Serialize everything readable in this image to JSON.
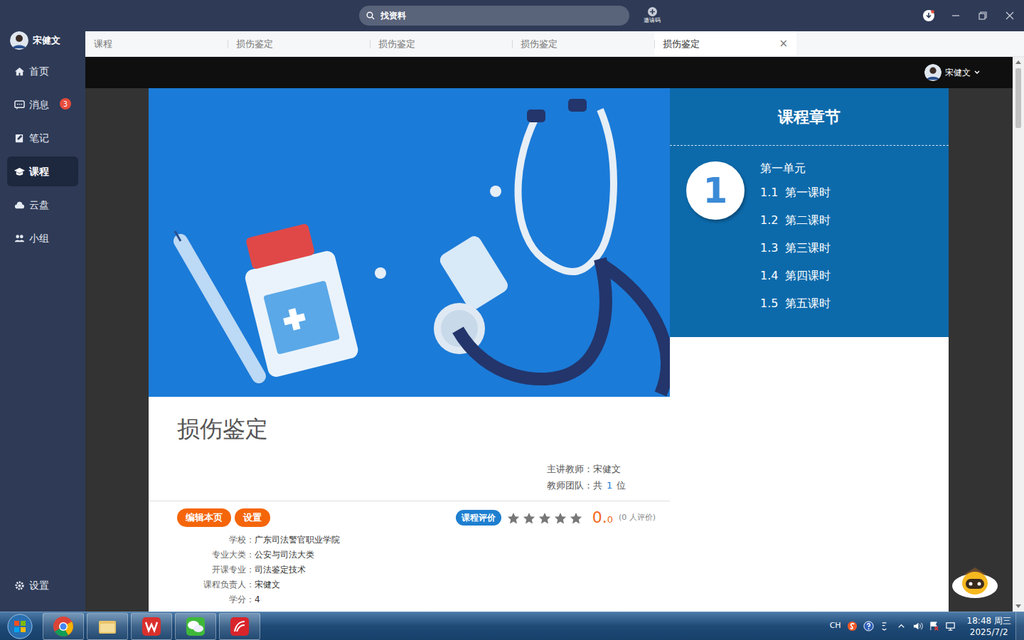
{
  "window": {
    "search_placeholder": "找资料",
    "invite_label": "邀请码"
  },
  "user": {
    "name": "宋健文"
  },
  "sidebar": {
    "items": [
      {
        "label": "首页",
        "selected": false
      },
      {
        "label": "消息",
        "badge": "3",
        "selected": false
      },
      {
        "label": "笔记",
        "selected": false
      },
      {
        "label": "课程",
        "selected": true
      },
      {
        "label": "云盘",
        "selected": false
      },
      {
        "label": "小组",
        "selected": false
      }
    ],
    "settings": "设置"
  },
  "tabs": [
    {
      "label": "课程",
      "selected": false
    },
    {
      "label": "损伤鉴定",
      "selected": false
    },
    {
      "label": "损伤鉴定",
      "selected": false
    },
    {
      "label": "损伤鉴定",
      "selected": false
    },
    {
      "label": "损伤鉴定",
      "selected": true,
      "close": "×"
    }
  ],
  "header": {
    "user": "宋健文"
  },
  "chapters": {
    "title": "课程章节",
    "unit_number": "1",
    "unit_title": "第一单元",
    "lessons": [
      {
        "number": "1.1",
        "title": "第一课时"
      },
      {
        "number": "1.2",
        "title": "第二课时"
      },
      {
        "number": "1.3",
        "title": "第三课时"
      },
      {
        "number": "1.4",
        "title": "第四课时"
      },
      {
        "number": "1.5",
        "title": "第五课时"
      }
    ]
  },
  "course": {
    "title": "损伤鉴定",
    "teacher_label": "主讲教师：",
    "teacher": "宋健文",
    "team_prefix": "教师团队：共",
    "team_count": "1",
    "team_suffix": "位",
    "buttons": [
      "编辑本页",
      "设置"
    ],
    "rating": {
      "label": "课程评价",
      "stars": 0,
      "score_main": "0.",
      "score_decimal": "0",
      "count": "(0 人评价)"
    },
    "info": [
      {
        "label": "学校：",
        "value": "广东司法警官职业学院"
      },
      {
        "label": "专业大类：",
        "value": "公安与司法大类"
      },
      {
        "label": "开课专业：",
        "value": "司法鉴定技术"
      },
      {
        "label": "课程负责人：",
        "value": "宋健文"
      },
      {
        "label": "学分：",
        "value": "4"
      }
    ]
  },
  "taskbar": {
    "language": "CH",
    "time": "18:48 周三",
    "date": "2025/7/2"
  }
}
